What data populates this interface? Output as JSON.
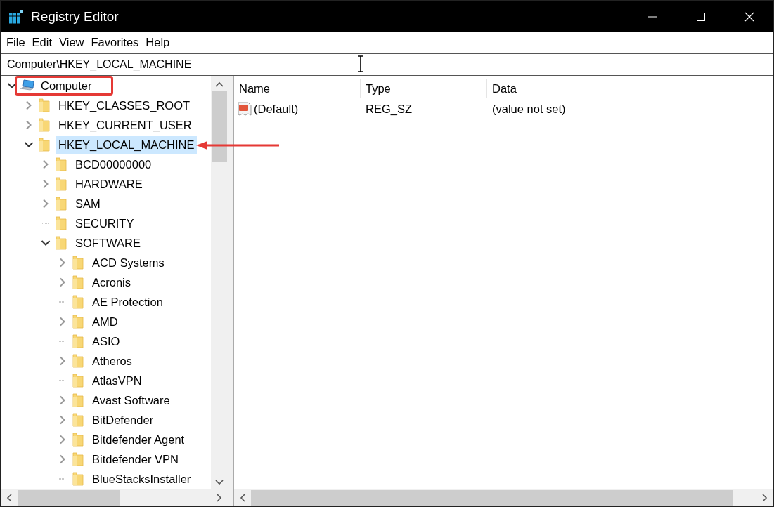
{
  "window": {
    "title": "Registry Editor"
  },
  "menu": [
    "File",
    "Edit",
    "View",
    "Favorites",
    "Help"
  ],
  "address": {
    "value": "Computer\\HKEY_LOCAL_MACHINE"
  },
  "tree": [
    {
      "label": "Computer",
      "kind": "computer",
      "expandable": true,
      "expanded": true,
      "selected": false,
      "framed": true,
      "arrow": false,
      "children": [
        {
          "label": "HKEY_CLASSES_ROOT",
          "kind": "folder",
          "expandable": true,
          "expanded": false,
          "selected": false,
          "framed": false,
          "arrow": false
        },
        {
          "label": "HKEY_CURRENT_USER",
          "kind": "folder",
          "expandable": true,
          "expanded": false,
          "selected": false,
          "framed": false,
          "arrow": false
        },
        {
          "label": "HKEY_LOCAL_MACHINE",
          "kind": "folder",
          "expandable": true,
          "expanded": true,
          "selected": true,
          "framed": false,
          "arrow": true,
          "children": [
            {
              "label": "BCD00000000",
              "kind": "folder",
              "expandable": true,
              "expanded": false,
              "selected": false,
              "framed": false,
              "arrow": false
            },
            {
              "label": "HARDWARE",
              "kind": "folder",
              "expandable": true,
              "expanded": false,
              "selected": false,
              "framed": false,
              "arrow": false
            },
            {
              "label": "SAM",
              "kind": "folder",
              "expandable": true,
              "expanded": false,
              "selected": false,
              "framed": false,
              "arrow": false
            },
            {
              "label": "SECURITY",
              "kind": "folder",
              "expandable": false,
              "selected": false,
              "framed": false,
              "arrow": false
            },
            {
              "label": "SOFTWARE",
              "kind": "folder",
              "expandable": true,
              "expanded": true,
              "selected": false,
              "framed": false,
              "arrow": false,
              "children": [
                {
                  "label": "ACD Systems",
                  "kind": "folder",
                  "expandable": true,
                  "expanded": false,
                  "selected": false,
                  "framed": false,
                  "arrow": false
                },
                {
                  "label": "Acronis",
                  "kind": "folder",
                  "expandable": true,
                  "expanded": false,
                  "selected": false,
                  "framed": false,
                  "arrow": false
                },
                {
                  "label": "AE Protection",
                  "kind": "folder",
                  "expandable": false,
                  "selected": false,
                  "framed": false,
                  "arrow": false
                },
                {
                  "label": "AMD",
                  "kind": "folder",
                  "expandable": true,
                  "expanded": false,
                  "selected": false,
                  "framed": false,
                  "arrow": false
                },
                {
                  "label": "ASIO",
                  "kind": "folder",
                  "expandable": false,
                  "selected": false,
                  "framed": false,
                  "arrow": false
                },
                {
                  "label": "Atheros",
                  "kind": "folder",
                  "expandable": true,
                  "expanded": false,
                  "selected": false,
                  "framed": false,
                  "arrow": false
                },
                {
                  "label": "AtlasVPN",
                  "kind": "folder",
                  "expandable": false,
                  "selected": false,
                  "framed": false,
                  "arrow": false
                },
                {
                  "label": "Avast Software",
                  "kind": "folder",
                  "expandable": true,
                  "expanded": false,
                  "selected": false,
                  "framed": false,
                  "arrow": false
                },
                {
                  "label": "BitDefender",
                  "kind": "folder",
                  "expandable": true,
                  "expanded": false,
                  "selected": false,
                  "framed": false,
                  "arrow": false
                },
                {
                  "label": "Bitdefender Agent",
                  "kind": "folder",
                  "expandable": true,
                  "expanded": false,
                  "selected": false,
                  "framed": false,
                  "arrow": false
                },
                {
                  "label": "Bitdefender VPN",
                  "kind": "folder",
                  "expandable": true,
                  "expanded": false,
                  "selected": false,
                  "framed": false,
                  "arrow": false
                },
                {
                  "label": "BlueStacksInstaller",
                  "kind": "folder",
                  "expandable": false,
                  "selected": false,
                  "framed": false,
                  "arrow": false
                }
              ]
            }
          ]
        }
      ]
    }
  ],
  "list": {
    "columns": [
      "Name",
      "Type",
      "Data"
    ],
    "rows": [
      {
        "name": "(Default)",
        "type": "REG_SZ",
        "data": "(value not set)"
      }
    ]
  }
}
